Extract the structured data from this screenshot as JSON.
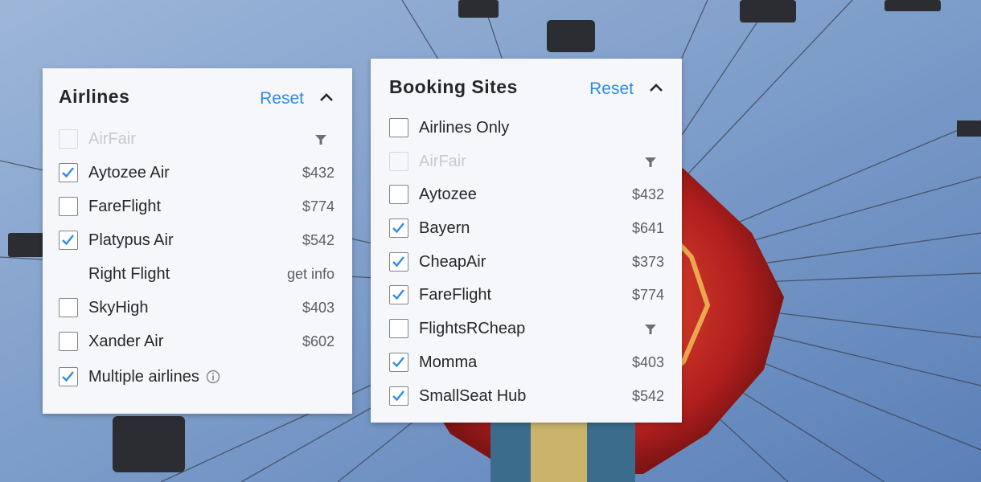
{
  "colors": {
    "accent": "#2e8ae6",
    "check": "#2e8ae6",
    "text": "#24272b",
    "muted": "#5a5f66",
    "disabled": "#c5cad2"
  },
  "airlines": {
    "title": "Airlines",
    "reset_label": "Reset",
    "collapse_icon": "chevron-up-icon",
    "items": [
      {
        "label": "AirFair",
        "checked": false,
        "disabled": true,
        "price": "",
        "icon": "filter-icon"
      },
      {
        "label": "Aytozee Air",
        "checked": true,
        "disabled": false,
        "price": "$432"
      },
      {
        "label": "FareFlight",
        "checked": false,
        "disabled": false,
        "price": "$774"
      },
      {
        "label": "Platypus Air",
        "checked": true,
        "disabled": false,
        "price": "$542"
      },
      {
        "label": "Right Flight",
        "checked": false,
        "disabled": false,
        "no_checkbox": true,
        "price": "get info"
      },
      {
        "label": "SkyHigh",
        "checked": false,
        "disabled": false,
        "price": "$403"
      },
      {
        "label": "Xander Air",
        "checked": false,
        "disabled": false,
        "price": "$602"
      },
      {
        "label": "Multiple airlines",
        "checked": true,
        "disabled": false,
        "price": "",
        "icon": "info-icon"
      }
    ]
  },
  "booking_sites": {
    "title": "Booking Sites",
    "reset_label": "Reset",
    "collapse_icon": "chevron-up-icon",
    "items": [
      {
        "label": "Airlines Only",
        "checked": false,
        "disabled": false,
        "price": ""
      },
      {
        "label": "AirFair",
        "checked": false,
        "disabled": true,
        "price": "",
        "icon": "filter-icon"
      },
      {
        "label": "Aytozee",
        "checked": false,
        "disabled": false,
        "price": "$432"
      },
      {
        "label": "Bayern",
        "checked": true,
        "disabled": false,
        "price": "$641"
      },
      {
        "label": "CheapAir",
        "checked": true,
        "disabled": false,
        "price": "$373"
      },
      {
        "label": "FareFlight",
        "checked": true,
        "disabled": false,
        "price": "$774"
      },
      {
        "label": "FlightsRCheap",
        "checked": false,
        "disabled": false,
        "price": "",
        "icon": "filter-icon"
      },
      {
        "label": "Momma",
        "checked": true,
        "disabled": false,
        "price": "$403"
      },
      {
        "label": "SmallSeat Hub",
        "checked": true,
        "disabled": false,
        "price": "$542"
      }
    ]
  }
}
